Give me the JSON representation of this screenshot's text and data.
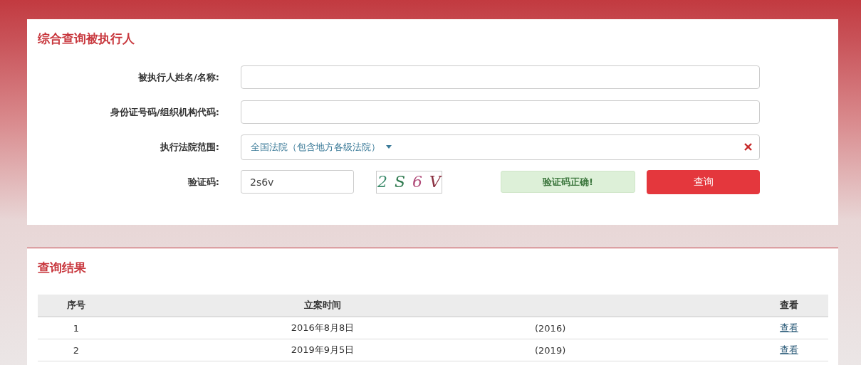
{
  "search_panel": {
    "title": "综合查询被执行人",
    "fields": [
      {
        "kind": "text",
        "label": "被执行人姓名/名称:"
      },
      {
        "kind": "text",
        "label": "身份证号码/组织机构代码:"
      },
      {
        "kind": "select",
        "label": "执行法院范围:",
        "value": "全国法院（包含地方各级法院）"
      },
      {
        "kind": "captcha",
        "label": "验证码:",
        "value": "2s6v",
        "captcha_chars": [
          {
            "char": "2",
            "color": "#3a8a6a"
          },
          {
            "char": "S",
            "color": "#2f7a4f"
          },
          {
            "char": "6",
            "color": "#b04a78"
          },
          {
            "char": "V",
            "color": "#8a3040"
          }
        ],
        "message": "验证码正确!",
        "button": "查询"
      }
    ]
  },
  "results": {
    "title": "查询结果",
    "columns": [
      "序号",
      "立案时间",
      "查看"
    ],
    "rows": [
      {
        "index": "1",
        "date": "2016年8月8日",
        "case_number": "(2016)",
        "link": "查看"
      },
      {
        "index": "2",
        "date": "2019年9月5日",
        "case_number": "(2019)",
        "link": "查看"
      }
    ]
  }
}
